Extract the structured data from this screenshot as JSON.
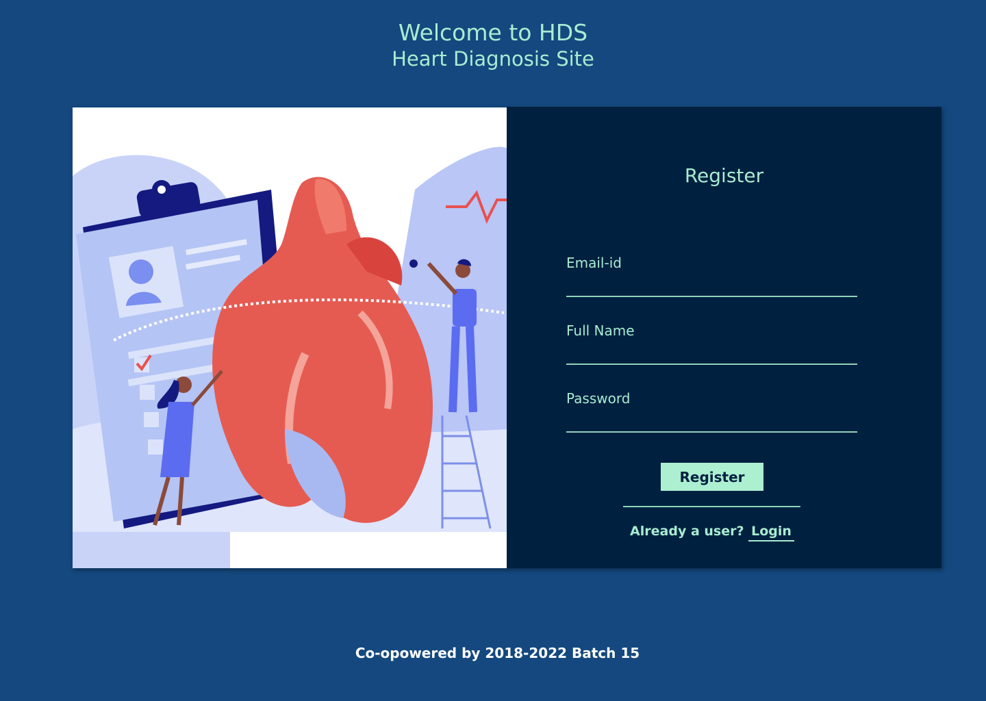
{
  "header": {
    "title": "Welcome to HDS",
    "subtitle": "Heart Diagnosis Site"
  },
  "illustration": {
    "icon": "heart-diagnosis-illustration"
  },
  "form": {
    "title": "Register",
    "fields": [
      {
        "label": "Email-id",
        "value": ""
      },
      {
        "label": "Full Name",
        "value": ""
      },
      {
        "label": "Password",
        "value": ""
      }
    ],
    "submit_label": "Register",
    "login_prompt": "Already a user?",
    "login_link": "Login"
  },
  "footer": {
    "text": "Co-opowered by 2018-2022 Batch 15"
  },
  "colors": {
    "page_bg": "#14487e",
    "panel_bg": "#00203f",
    "accent": "#a8ecd2",
    "button_bg": "#adefd1"
  }
}
